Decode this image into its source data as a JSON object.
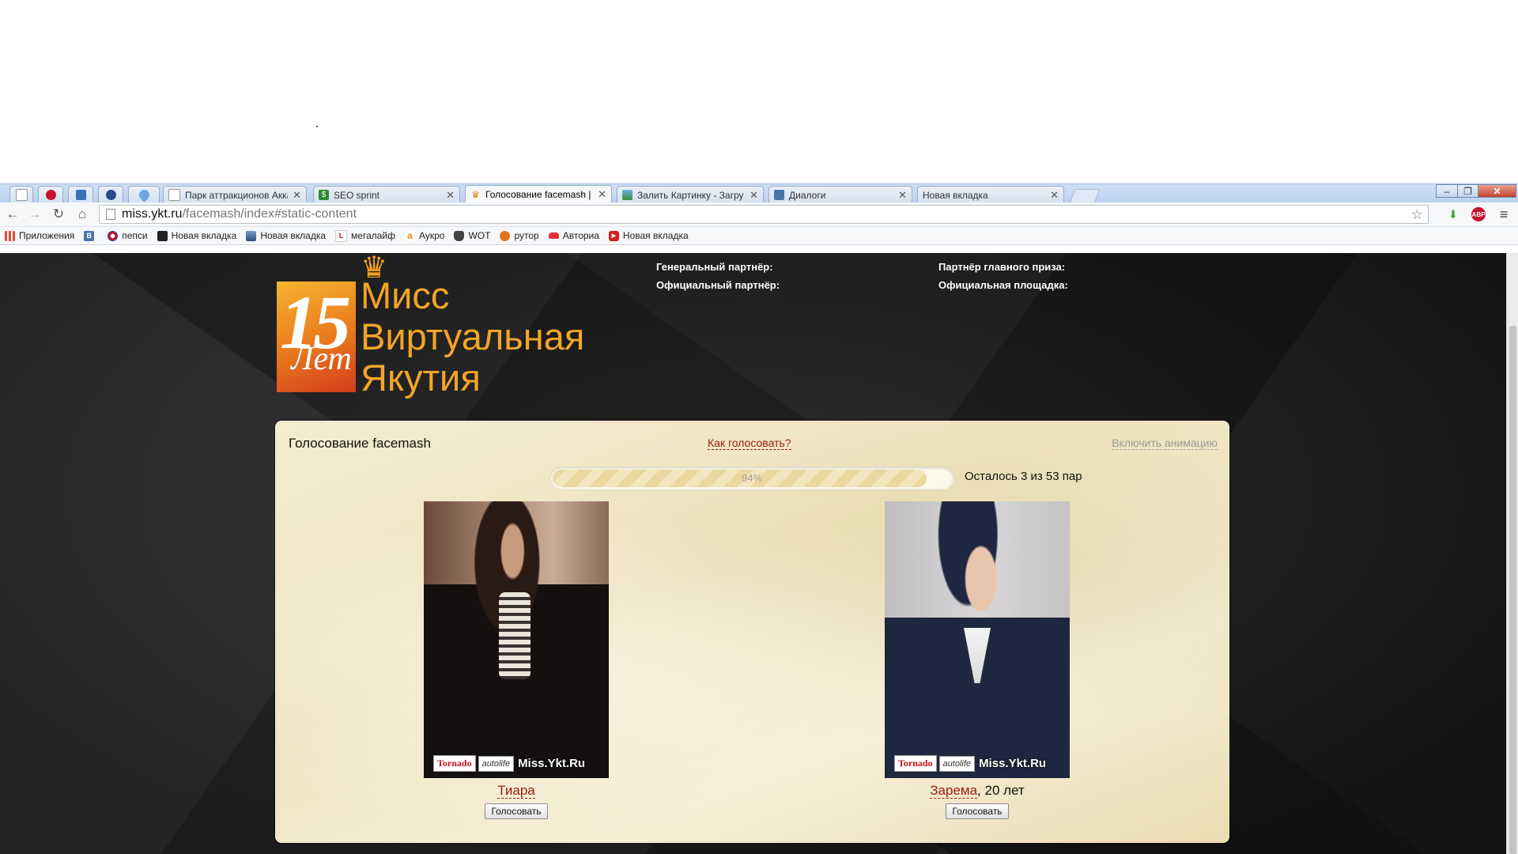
{
  "browser": {
    "tabs": [
      {
        "title": "",
        "icon": "page-icon",
        "pinned": true
      },
      {
        "title": "",
        "icon": "opera-icon",
        "pinned": true
      },
      {
        "title": "",
        "icon": "shield-icon",
        "pinned": true
      },
      {
        "title": "",
        "icon": "pinterest-icon",
        "pinned": true
      },
      {
        "title": "",
        "icon": "heart-icon",
        "pinned": true
      },
      {
        "title": "Парк аттракционов Акка",
        "icon": "page-icon"
      },
      {
        "title": "SEO sprint",
        "icon": "dollar-icon"
      },
      {
        "title": "Голосование facemash | ",
        "icon": "crown-icon",
        "active": true
      },
      {
        "title": "Залить Картинку - Загру",
        "icon": "image-icon"
      },
      {
        "title": "Диалоги",
        "icon": "vk-icon"
      },
      {
        "title": "Новая вкладка",
        "icon": ""
      }
    ],
    "url_host": "miss.ykt.ru",
    "url_path": "/facemash/index#static-content",
    "bookmarks": [
      {
        "label": "Приложения",
        "icon": "apps-icon"
      },
      {
        "label": "",
        "icon": "vk-icon"
      },
      {
        "label": "пепси",
        "icon": "pepsi-icon"
      },
      {
        "label": "Новая вкладка",
        "icon": "folder-icon"
      },
      {
        "label": "Новая вкладка",
        "icon": "folder-icon"
      },
      {
        "label": "мегалайф",
        "icon": "megalife-icon"
      },
      {
        "label": "Аукро",
        "icon": "aukro-icon"
      },
      {
        "label": "WOT",
        "icon": "wot-icon"
      },
      {
        "label": "рутор",
        "icon": "rutor-icon"
      },
      {
        "label": "Авториа",
        "icon": "car-icon"
      },
      {
        "label": "Новая вкладка",
        "icon": "youtube-icon"
      }
    ]
  },
  "logo": {
    "number": "15",
    "years": "Лет",
    "lines": [
      "Мисс",
      "Виртуальная",
      "Якутия"
    ]
  },
  "partners": {
    "general": "Генеральный партнёр:",
    "official": "Официальный партнёр:",
    "main_prize": "Партнёр главного приза:",
    "platform": "Официальная площадка:"
  },
  "panel": {
    "title": "Голосование facemash",
    "how_to_vote": "Как голосовать?",
    "enable_animation": "Включить анимацию",
    "progress_percent": 94,
    "progress_label": "94%",
    "remaining": "Осталось 3 из 53 пар",
    "contestants": [
      {
        "name": "Тиара",
        "age": "",
        "vote_label": "Голосовать"
      },
      {
        "name": "Зарема",
        "age": ", 20 лет",
        "vote_label": "Голосовать"
      }
    ],
    "watermark": {
      "brand1": "Tornado",
      "brand2": "autolife",
      "site": "Miss.Ykt.Ru"
    }
  },
  "colors": {
    "accent": "#f3a527",
    "link": "#9a1b0e"
  }
}
